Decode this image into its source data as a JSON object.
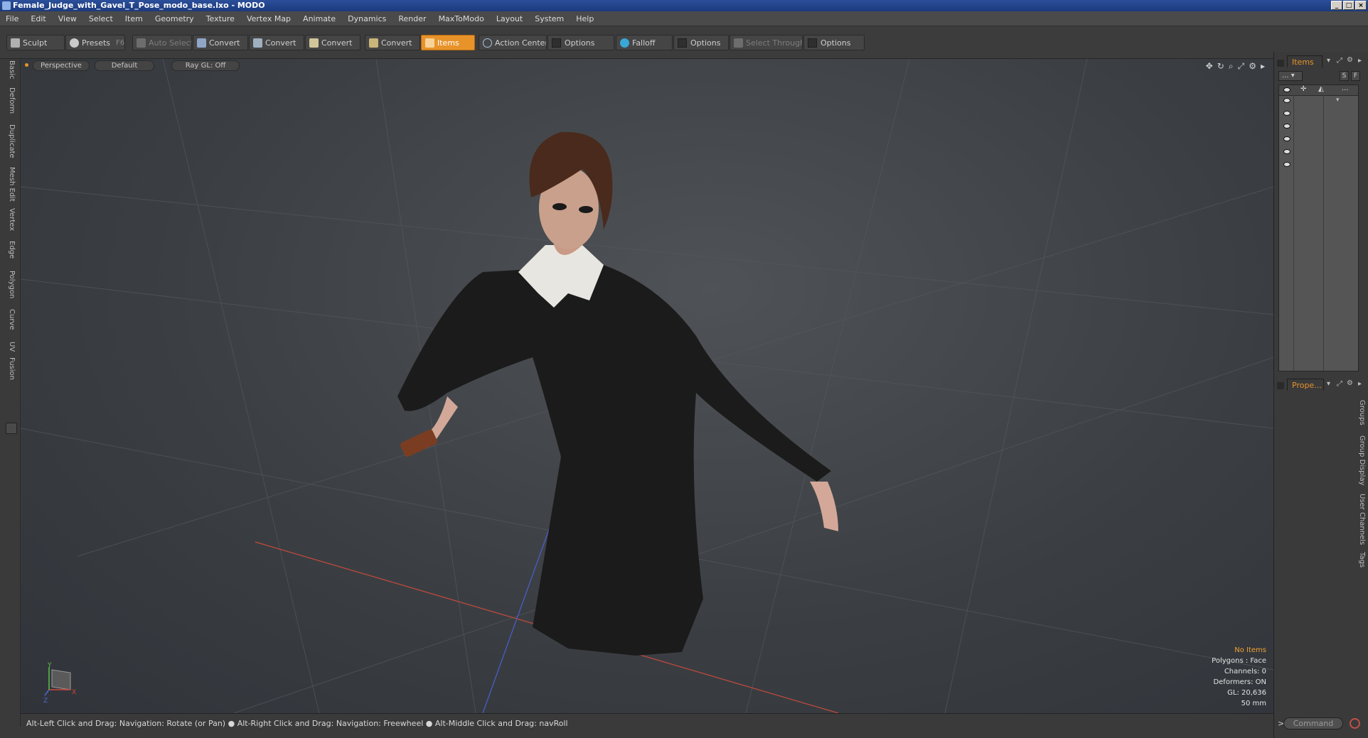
{
  "window": {
    "title": "Female_Judge_with_Gavel_T_Pose_modo_base.lxo - MODO",
    "controls": [
      "_",
      "□",
      "×"
    ]
  },
  "menu": [
    "File",
    "Edit",
    "View",
    "Select",
    "Item",
    "Geometry",
    "Texture",
    "Vertex Map",
    "Animate",
    "Dynamics",
    "Render",
    "MaxToModo",
    "Layout",
    "System",
    "Help"
  ],
  "toolbar": {
    "sculpt": "Sculpt",
    "presets": "Presets",
    "presets_key": "F6",
    "auto_select": "Auto Select",
    "convert_1": "Convert",
    "convert_2": "Convert",
    "convert_3": "Convert",
    "convert_4": "Convert",
    "items": "Items",
    "action_center": "Action Center",
    "options_1": "Options",
    "falloff": "Falloff",
    "options_2": "Options",
    "select_through": "Select Through",
    "options_3": "Options"
  },
  "left_tabs": [
    "Basic",
    "Deform",
    "Duplicate",
    "Mesh Edit",
    "Vertex",
    "Edge",
    "Polygon",
    "Curve",
    "UV",
    "Fusion"
  ],
  "viewport": {
    "view": "Perspective",
    "shading": "Default",
    "raygl": "Ray GL: Off",
    "stats": {
      "selection": "No Items",
      "polygons": "Polygons : Face",
      "channels": "Channels: 0",
      "deformers": "Deformers: ON",
      "gl": "GL: 20,636",
      "focal": "50 mm"
    },
    "axis": {
      "x": "X",
      "y": "Y",
      "z": "Z"
    }
  },
  "status_bar": "Alt-Left Click and Drag: Navigation: Rotate (or Pan) ● Alt-Right Click and Drag: Navigation: Freewheel ● Alt-Middle Click and Drag: navRoll",
  "right_panel": {
    "items_tab": "Items",
    "list_dropdown": "...",
    "btn_s": "S",
    "btn_f": "F",
    "header_more": "...",
    "properties_tab": "Prope...",
    "side_tabs": [
      "Groups",
      "Group Display",
      "User Channels",
      "Tags"
    ],
    "command": "Command",
    "prompt": ">"
  },
  "colors": {
    "accent": "#e8932a",
    "title_bar": "#2b4f9a",
    "axis_x": "#d0453a",
    "axis_y": "#5fbf4a",
    "axis_z": "#4a6ad0"
  }
}
